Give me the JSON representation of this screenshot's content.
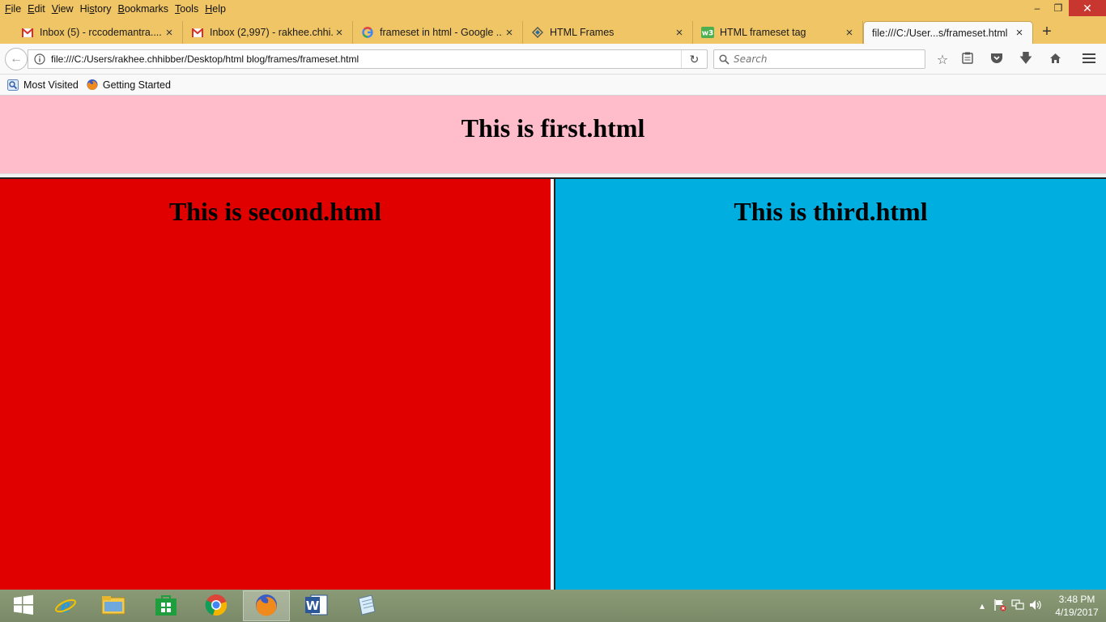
{
  "menu": {
    "items": [
      {
        "pre": "",
        "u": "F",
        "post": "ile"
      },
      {
        "pre": "",
        "u": "E",
        "post": "dit"
      },
      {
        "pre": "",
        "u": "V",
        "post": "iew"
      },
      {
        "pre": "Hi",
        "u": "s",
        "post": "tory"
      },
      {
        "pre": "",
        "u": "B",
        "post": "ookmarks"
      },
      {
        "pre": "",
        "u": "T",
        "post": "ools"
      },
      {
        "pre": "",
        "u": "H",
        "post": "elp"
      }
    ]
  },
  "tabs": [
    {
      "label": "Inbox (5) - rccodemantra....",
      "icon": "gmail-icon"
    },
    {
      "label": "Inbox (2,997) - rakhee.chhi...",
      "icon": "gmail-icon"
    },
    {
      "label": "frameset in html - Google ...",
      "icon": "google-icon"
    },
    {
      "label": "HTML Frames",
      "icon": "tutorialspoint-icon"
    },
    {
      "label": "HTML frameset tag",
      "icon": "w3schools-icon"
    },
    {
      "label": "file:///C:/User...s/frameset.html",
      "icon": "",
      "active": true
    }
  ],
  "nav": {
    "url": "file:///C:/Users/rakhee.chhibber/Desktop/html blog/frames/frameset.html",
    "search_placeholder": "Search"
  },
  "bookmarks": [
    {
      "label": "Most Visited",
      "icon": "most-visited-icon"
    },
    {
      "label": "Getting Started",
      "icon": "firefox-icon"
    }
  ],
  "frames": {
    "first": {
      "heading": "This is first.html",
      "bg": "#ffbcca"
    },
    "second": {
      "heading": "This is second.html",
      "bg": "#e00000"
    },
    "third": {
      "heading": "This is third.html",
      "bg": "#00aee0"
    }
  },
  "taskbar": {
    "items": [
      "windows-start-icon",
      "internet-explorer-icon",
      "file-explorer-icon",
      "windows-store-icon",
      "chrome-icon",
      "firefox-icon",
      "word-icon",
      "notepad-icon"
    ],
    "time": "3:48 PM",
    "date": "4/19/2017"
  }
}
